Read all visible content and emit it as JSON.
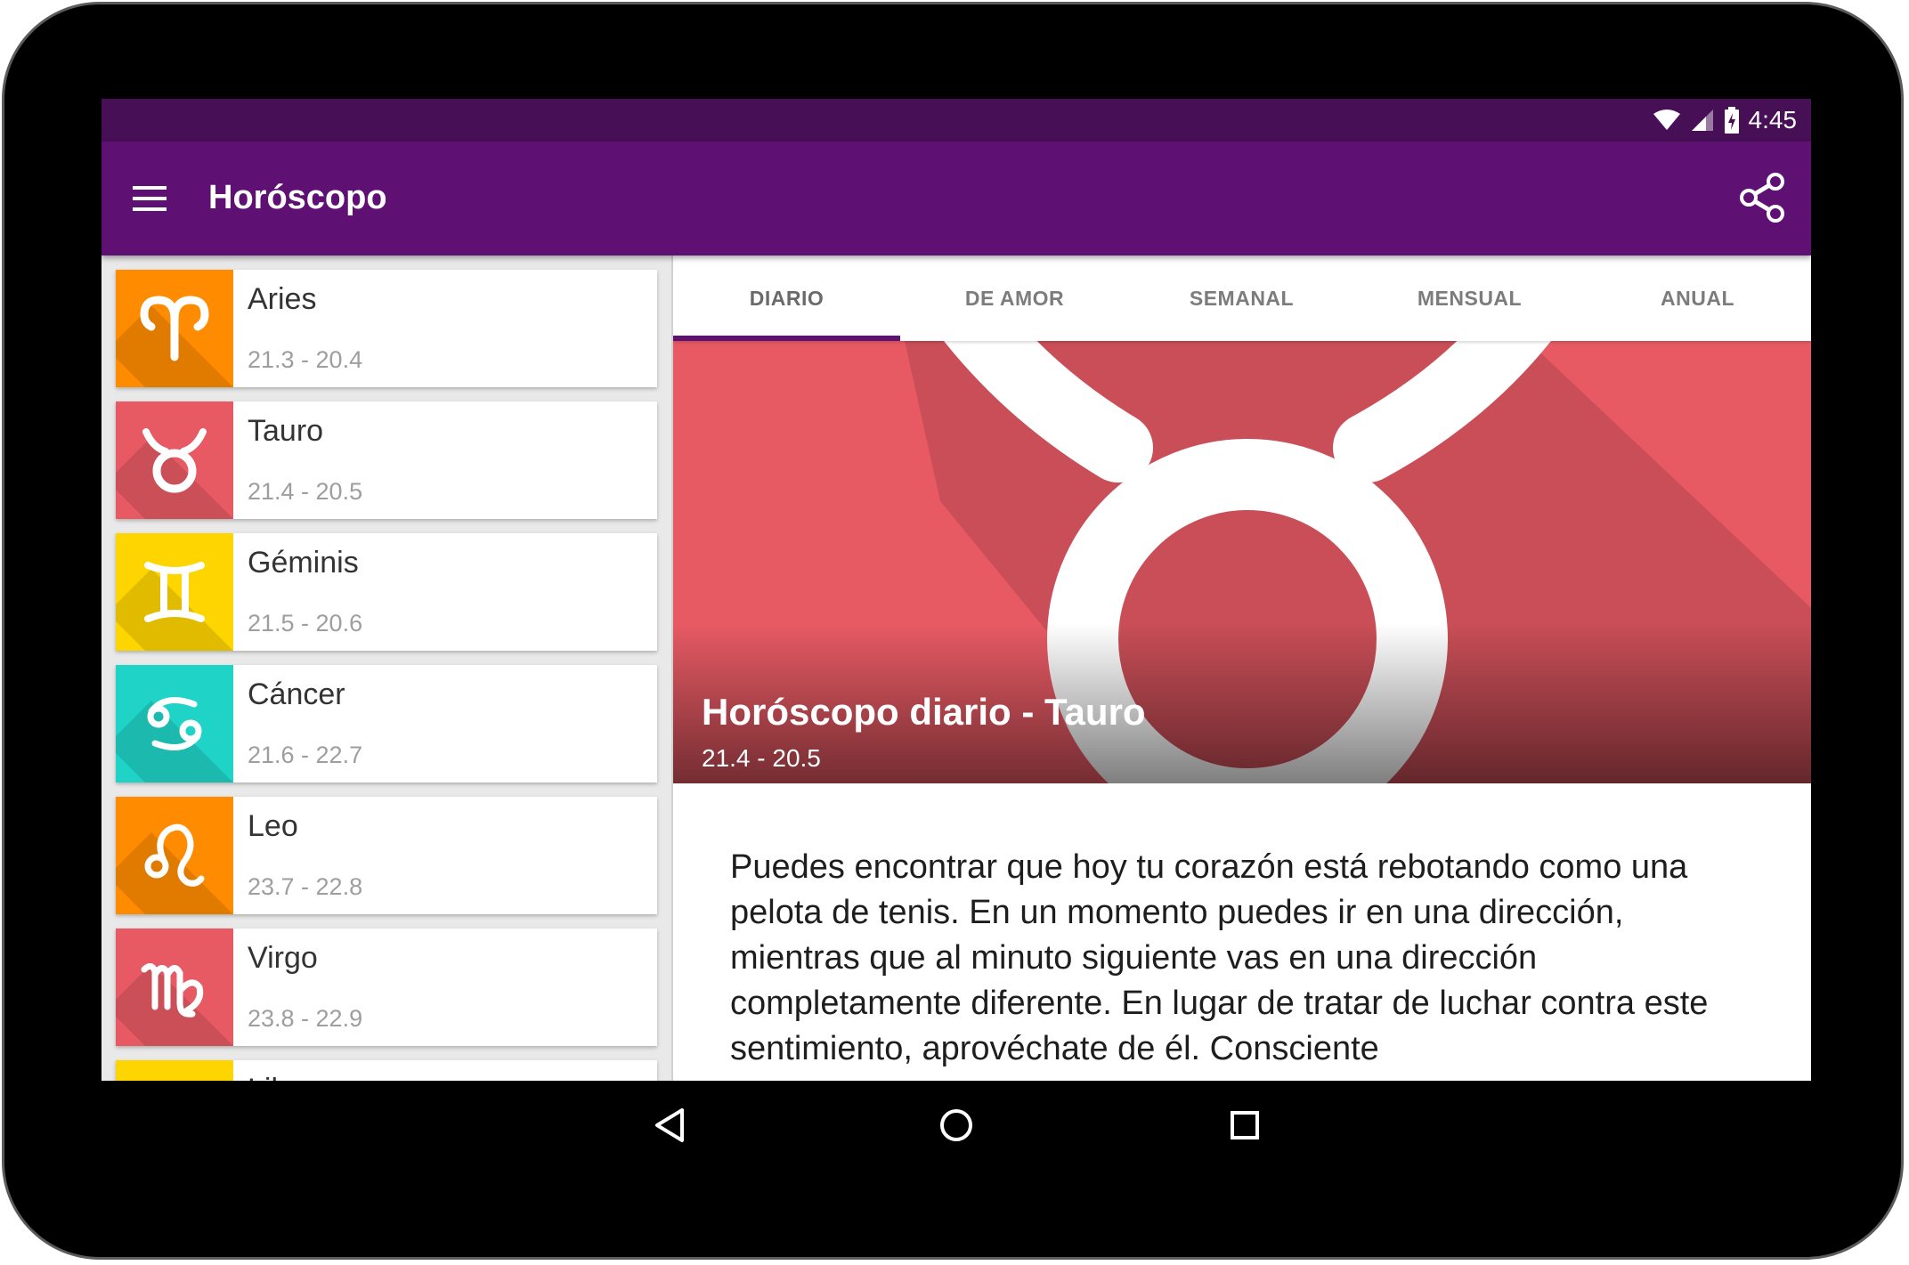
{
  "status_bar": {
    "time": "4:45",
    "icons": [
      "wifi-icon",
      "signal-icon",
      "battery-charging-icon"
    ]
  },
  "app_bar": {
    "title": "Horóscopo",
    "menu_icon": "menu-icon",
    "share_icon": "share-icon"
  },
  "signs": [
    {
      "name": "Aries",
      "dates": "21.3 - 20.4",
      "color": "#ff8c00",
      "icon": "aries-icon"
    },
    {
      "name": "Tauro",
      "dates": "21.4 - 20.5",
      "color": "#e75a64",
      "icon": "taurus-icon"
    },
    {
      "name": "Géminis",
      "dates": "21.5 - 20.6",
      "color": "#ffd500",
      "icon": "gemini-icon"
    },
    {
      "name": "Cáncer",
      "dates": "21.6 - 22.7",
      "color": "#1fd3c6",
      "icon": "cancer-icon"
    },
    {
      "name": "Leo",
      "dates": "23.7 - 22.8",
      "color": "#ff8c00",
      "icon": "leo-icon"
    },
    {
      "name": "Virgo",
      "dates": "23.8 - 22.9",
      "color": "#e75a64",
      "icon": "virgo-icon"
    },
    {
      "name": "Libra",
      "dates": "",
      "color": "#ffd500",
      "icon": "libra-icon"
    }
  ],
  "tabs": [
    {
      "label": "DIARIO",
      "active": true
    },
    {
      "label": "DE AMOR",
      "active": false
    },
    {
      "label": "SEMANAL",
      "active": false
    },
    {
      "label": "MENSUAL",
      "active": false
    },
    {
      "label": "ANUAL",
      "active": false
    }
  ],
  "hero": {
    "title": "Horóscopo diario - Tauro",
    "dates": "21.4 - 20.5",
    "color": "#e75a64",
    "icon": "taurus-icon"
  },
  "horoscope_text": "Puedes encontrar que hoy tu corazón está rebotando como una pelota de tenis. En un momento puedes ir en una dirección, mientras que al minuto siguiente vas en una dirección completamente diferente. En lugar de tratar de luchar contra este sentimiento, aprovéchate de él. Consciente",
  "nav": {
    "back_icon": "back-icon",
    "home_icon": "home-icon",
    "recents_icon": "recents-icon"
  }
}
